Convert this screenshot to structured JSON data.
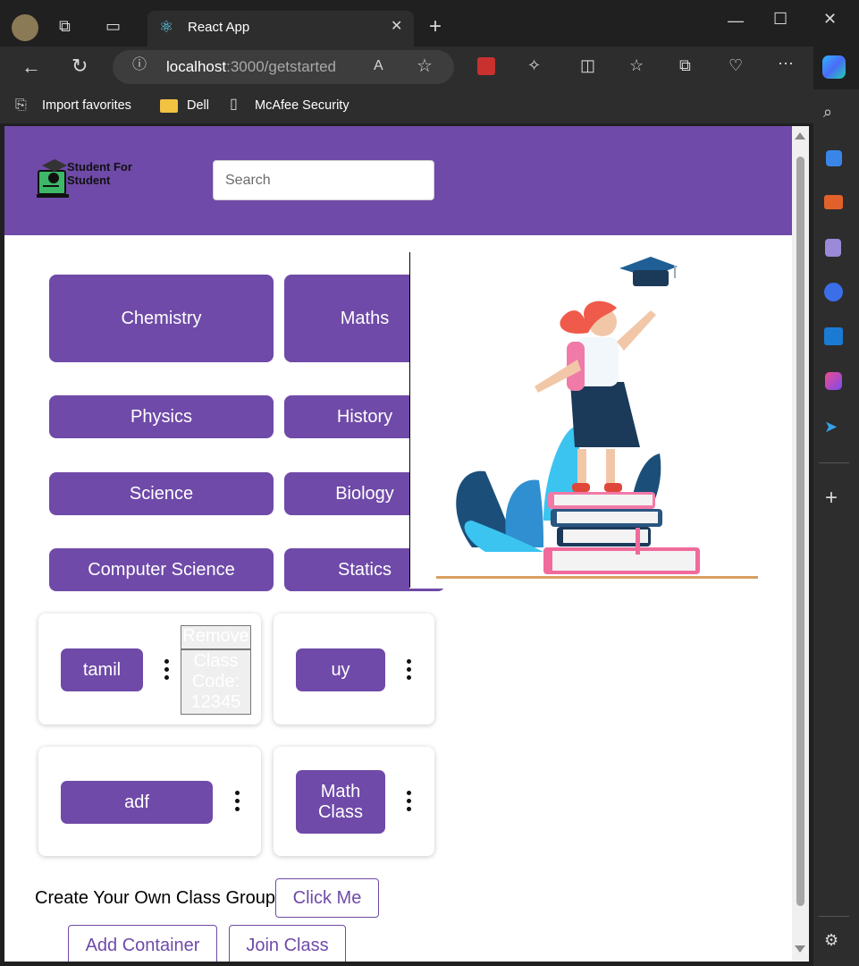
{
  "browser": {
    "tab_title": "React App",
    "url_host": "localhost",
    "url_path": ":3000/getstarted",
    "favorites": [
      "Import favorites",
      "Dell",
      "McAfee Security"
    ]
  },
  "header": {
    "logo_text": "Student For Student",
    "search_placeholder": "Search"
  },
  "subjects": [
    "Chemistry",
    "Maths",
    "Physics",
    "History",
    "Science",
    "Biology",
    "Computer Science",
    "Statics"
  ],
  "classes": [
    {
      "name": "tamil",
      "remove_label": "Remove",
      "code_label": "Class Code: 12345"
    },
    {
      "name": "uy"
    },
    {
      "name": "adf"
    },
    {
      "name": "Math Class"
    }
  ],
  "create": {
    "text": "Create Your Own Class Group",
    "click_me": "Click Me",
    "add_container": "Add Container",
    "join_class": "Join Class"
  }
}
